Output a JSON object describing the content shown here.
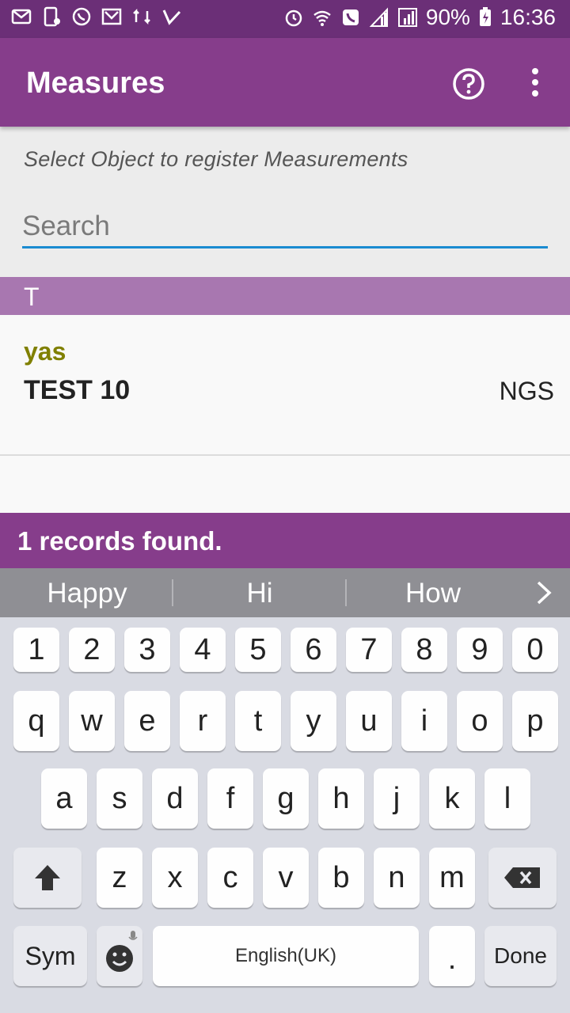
{
  "status_bar": {
    "left_icons": [
      "mail-icon",
      "phone-message-icon",
      "whatsapp-icon",
      "gmail-icon",
      "transfer-icon",
      "check-icon"
    ],
    "right_icons": [
      "alarm-icon",
      "wifi-calling-icon",
      "call-icon",
      "signal-icon",
      "signal-r-icon"
    ],
    "battery": "90%",
    "time": "16:36"
  },
  "app_bar": {
    "title": "Measures",
    "help_icon": "help-circle-icon",
    "more_icon": "more-vert-icon"
  },
  "filter": {
    "hint": "Select Object to register Measurements",
    "search_placeholder": "Search",
    "search_value": ""
  },
  "list": {
    "section_letter": "T",
    "items": [
      {
        "subtitle": "yas",
        "title": "TEST 10",
        "right": "NGS"
      }
    ]
  },
  "records_text": "1 records found.",
  "keyboard": {
    "suggestions": [
      "Happy",
      "Hi",
      "How"
    ],
    "row_numbers": [
      "1",
      "2",
      "3",
      "4",
      "5",
      "6",
      "7",
      "8",
      "9",
      "0"
    ],
    "row1": [
      "q",
      "w",
      "e",
      "r",
      "t",
      "y",
      "u",
      "i",
      "o",
      "p"
    ],
    "row2": [
      "a",
      "s",
      "d",
      "f",
      "g",
      "h",
      "j",
      "k",
      "l"
    ],
    "row3": [
      "z",
      "x",
      "c",
      "v",
      "b",
      "n",
      "m"
    ],
    "sym_label": "Sym",
    "space_label": "English(UK)",
    "period_label": ".",
    "done_label": "Done"
  },
  "colors": {
    "status_bar": "#6b2f77",
    "app_bar": "#863d8b",
    "section_header": "#a877b0",
    "subtitle": "#808000",
    "search_underline": "#1a8bd1"
  }
}
